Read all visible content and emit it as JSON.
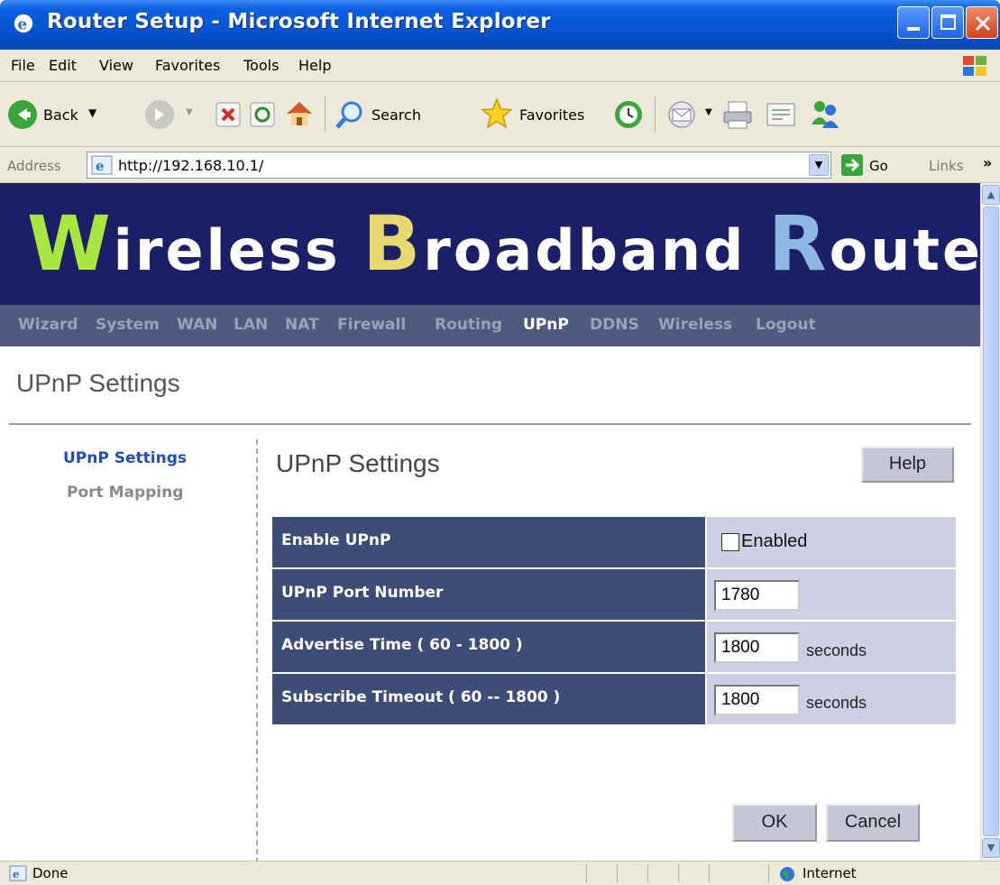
{
  "window": {
    "title": "Router Setup - Microsoft Internet Explorer"
  },
  "menubar": {
    "items": [
      "File",
      "Edit",
      "View",
      "Favorites",
      "Tools",
      "Help"
    ]
  },
  "toolbar": {
    "back_label": "Back",
    "search_label": "Search",
    "favorites_label": "Favorites"
  },
  "addressbar": {
    "label": "Address",
    "url": "http://192.168.10.1/",
    "go_label": "Go",
    "links_label": "Links"
  },
  "banner": {
    "parts": [
      {
        "initial": "W",
        "rest": "ireless ",
        "initial_color": "#a8e640"
      },
      {
        "initial": "B",
        "rest": "roadband ",
        "initial_color": "#e6d96e"
      },
      {
        "initial": "R",
        "rest": "outer",
        "initial_color": "#8fb7e3"
      }
    ]
  },
  "nav": {
    "items": [
      "Wizard",
      "System",
      "WAN",
      "LAN",
      "NAT",
      "Firewall",
      "Routing",
      "UPnP",
      "DDNS",
      "Wireless",
      "Logout"
    ],
    "active": "UPnP"
  },
  "page": {
    "heading": "UPnP Settings"
  },
  "sidebar": {
    "items": [
      {
        "label": "UPnP Settings",
        "active": true
      },
      {
        "label": "Port Mapping",
        "active": false
      }
    ]
  },
  "section": {
    "title": "UPnP Settings",
    "help_label": "Help"
  },
  "form": {
    "enable_upnp": {
      "label": "Enable UPnP",
      "checkbox_label": "Enabled",
      "checked": false
    },
    "port_number": {
      "label": "UPnP Port Number",
      "value": "1780"
    },
    "advertise_time": {
      "label": "Advertise Time ( 60 - 1800 )",
      "value": "1800",
      "unit": "seconds"
    },
    "subscribe_timeout": {
      "label": "Subscribe Timeout ( 60 -- 1800 )",
      "value": "1800",
      "unit": "seconds"
    }
  },
  "actions": {
    "ok_label": "OK",
    "cancel_label": "Cancel"
  },
  "statusbar": {
    "status": "Done",
    "zone": "Internet"
  },
  "colors": {
    "banner_bg": "#1a1f66",
    "nav_bg": "#4e5b7e",
    "label_bg": "#3e4d75",
    "value_bg": "#cdd0e2",
    "link_active": "#1f4fb0",
    "link_inactive": "#8a8a8a"
  }
}
